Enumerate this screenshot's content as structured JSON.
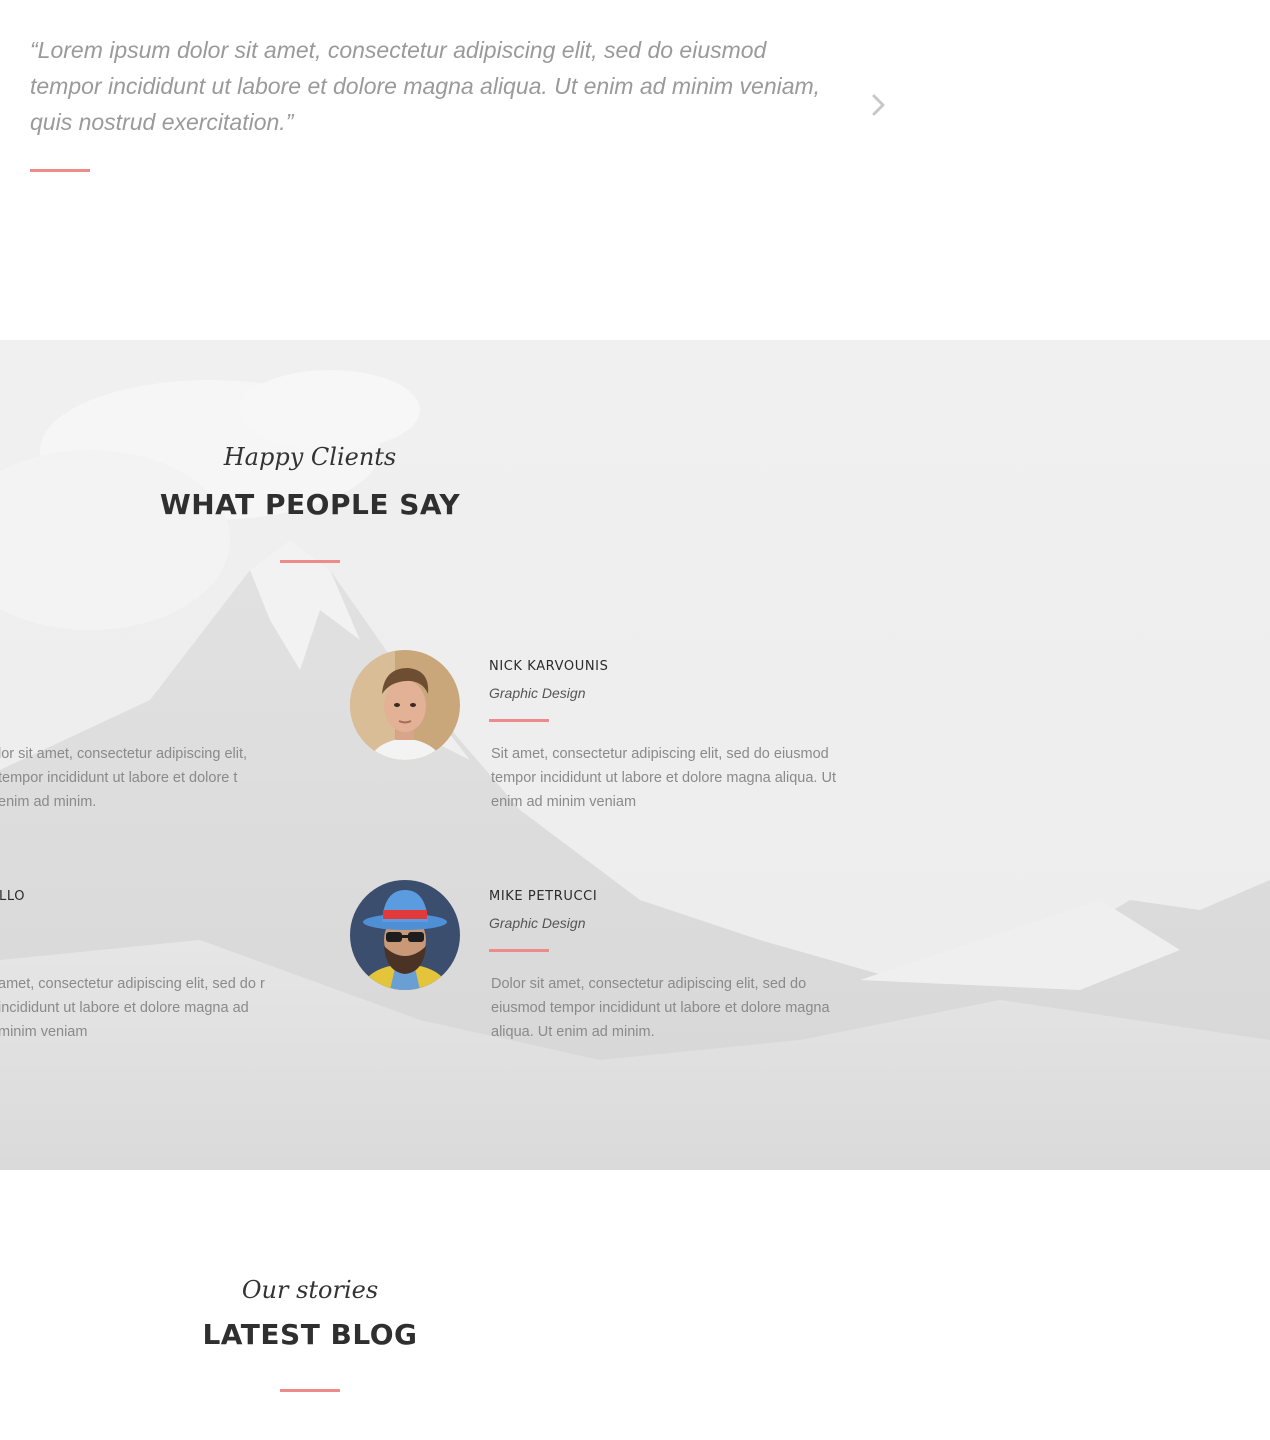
{
  "quote": {
    "text": "“Lorem ipsum dolor sit amet, consectetur adipiscing elit, sed do eiusmod tempor incididunt ut labore et dolore magna aliqua. Ut enim ad minim veniam, quis nostrud exercitation.”",
    "next_icon": "chevron-right-icon"
  },
  "testimonials": {
    "subtitle": "Happy Clients",
    "title": "WHAT PEOPLE SAY",
    "clients": [
      {
        "name": "NICK KARVOUNIS",
        "role": "Graphic Design",
        "text": "Sit amet, consectetur adipiscing elit, sed do eiusmod tempor incididunt ut labore et dolore magna aliqua. Ut enim ad minim veniam"
      },
      {
        "name": "MIKE PETRUCCI",
        "role": "Graphic Design",
        "text": "Dolor sit amet, consectetur adipiscing elit, sed do eiusmod tempor incididunt ut labore et dolore magna aliqua. Ut enim ad minim."
      }
    ],
    "partial_clients": [
      {
        "name": "LLO",
        "text": "lor sit amet, consectetur adipiscing elit, tempor incididunt ut labore et dolore t enim ad minim."
      },
      {
        "text": "amet, consectetur adipiscing elit, sed do r incididunt ut labore et dolore magna ad minim veniam"
      }
    ]
  },
  "blog": {
    "subtitle": "Our stories",
    "title": "LATEST BLOG"
  },
  "colors": {
    "accent": "#ef8a8a",
    "heading": "#2f2f2f",
    "muted_text": "#8a8a8a"
  }
}
